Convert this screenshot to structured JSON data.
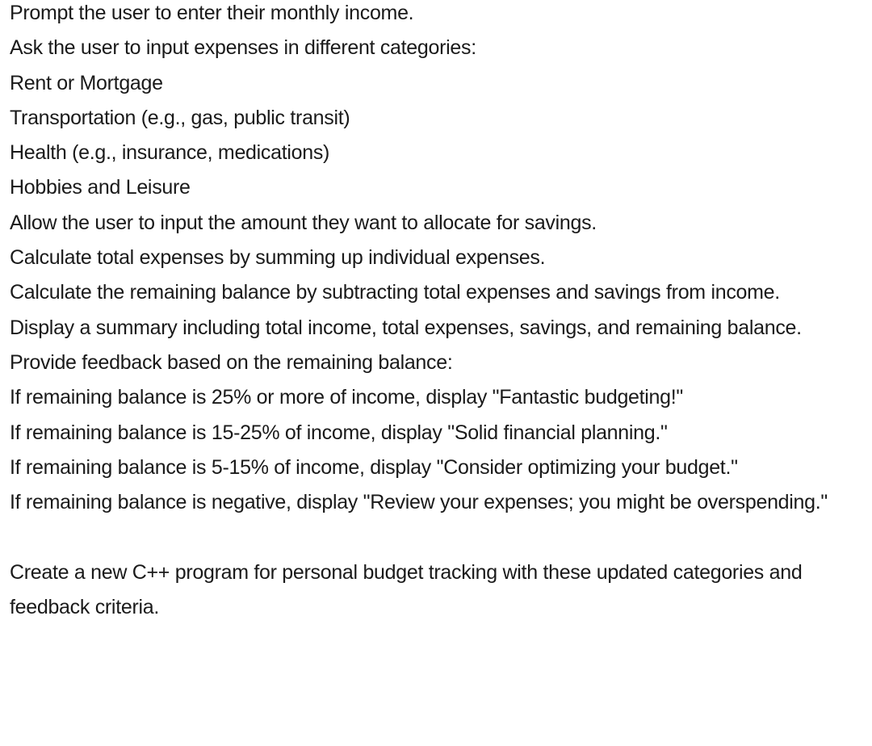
{
  "lines": [
    "Prompt the user to enter their monthly income.",
    "Ask the user to input expenses in different categories:",
    "Rent or Mortgage",
    "Transportation (e.g., gas, public transit)",
    "Health (e.g., insurance, medications)",
    "Hobbies and Leisure",
    "Allow the user to input the amount they want to allocate for savings.",
    "Calculate total expenses by summing up individual expenses.",
    "Calculate the remaining balance by subtracting total expenses and savings from income.",
    "Display a summary including total income, total expenses, savings, and remaining balance.",
    "Provide feedback based on the remaining balance:",
    "If remaining balance is 25% or more of income, display \"Fantastic budgeting!\"",
    "If remaining balance is 15-25% of income, display \"Solid financial planning.\"",
    "If remaining balance is 5-15% of income, display \"Consider optimizing your budget.\"",
    "If remaining balance is negative, display \"Review your expenses; you might be overspending.\""
  ],
  "closing": "Create a new C++ program for personal budget tracking with these updated categories and feedback criteria."
}
